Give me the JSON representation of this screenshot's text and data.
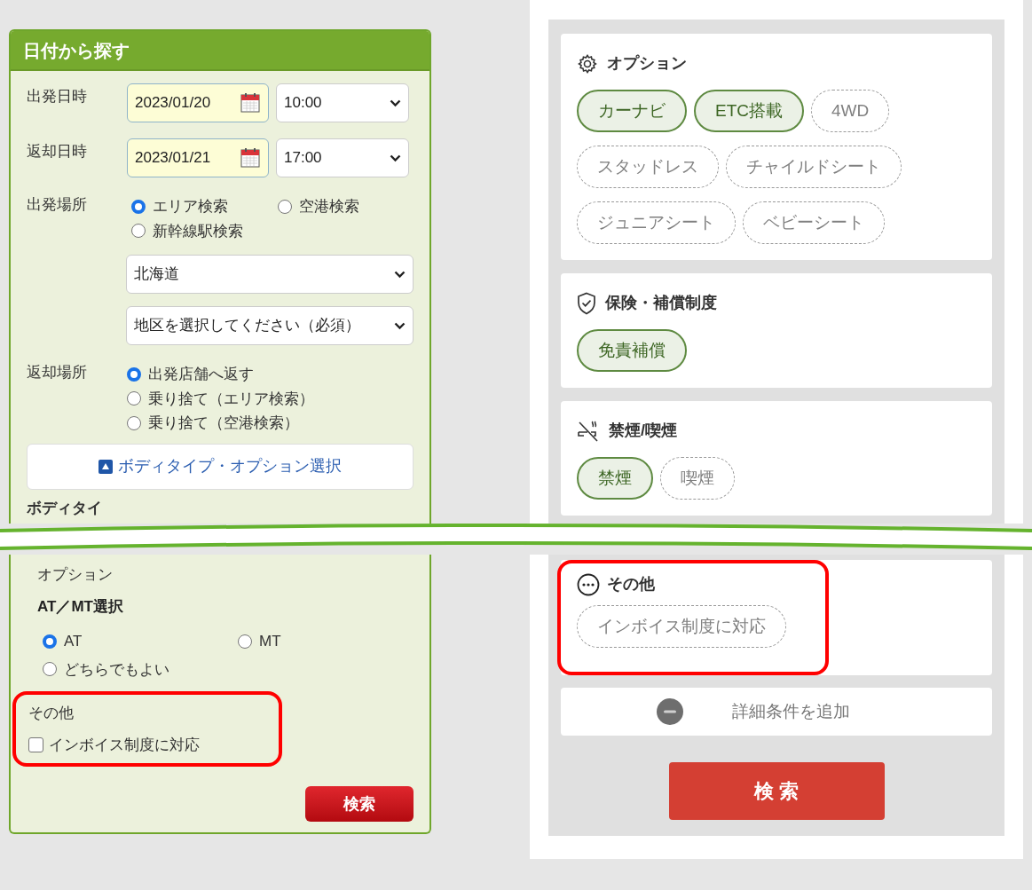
{
  "left_panel": {
    "title": "日付から探す",
    "datetime_rows": [
      {
        "label": "出発日時",
        "date": "2023/01/20",
        "time": "10:00"
      },
      {
        "label": "返却日時",
        "date": "2023/01/21",
        "time": "17:00"
      }
    ],
    "departure_place": {
      "label": "出発場所",
      "options": [
        {
          "label": "エリア検索",
          "selected": true
        },
        {
          "label": "空港検索",
          "selected": false
        },
        {
          "label": "新幹線駅検索",
          "selected": false
        }
      ],
      "selects": [
        "北海道",
        "地区を選択してください（必須）"
      ]
    },
    "return_place": {
      "label": "返却場所",
      "options": [
        {
          "label": "出発店舗へ返す",
          "selected": true
        },
        {
          "label": "乗り捨て（エリア検索）",
          "selected": false
        },
        {
          "label": "乗り捨て（空港検索）",
          "selected": false
        }
      ]
    },
    "toggle_button": "ボディタイプ・オプション選択",
    "cut_heading": "ボディタイ",
    "options_heading": "オプション",
    "transmission": {
      "label": "AT／MT選択",
      "options": [
        {
          "label": "AT",
          "selected": true
        },
        {
          "label": "MT",
          "selected": false
        },
        {
          "label": "どちらでもよい",
          "selected": false
        }
      ]
    },
    "other": {
      "label": "その他",
      "highlighted": true,
      "checkboxes": [
        {
          "label": "インボイス制度に対応",
          "checked": false
        }
      ]
    },
    "search_button": "検索"
  },
  "right_panel": {
    "sections": [
      {
        "title": "オプション",
        "chips": [
          {
            "label": "カーナビ",
            "selected": true
          },
          {
            "label": "ETC搭載",
            "selected": true
          },
          {
            "label": "4WD",
            "selected": false
          },
          {
            "label": "スタッドレス",
            "selected": false
          },
          {
            "label": "チャイルドシート",
            "selected": false
          },
          {
            "label": "ジュニアシート",
            "selected": false
          },
          {
            "label": "ベビーシート",
            "selected": false
          }
        ]
      },
      {
        "title": "保険・補償制度",
        "chips": [
          {
            "label": "免責補償",
            "selected": true
          }
        ]
      },
      {
        "title": "禁煙/喫煙",
        "chips": [
          {
            "label": "禁煙",
            "selected": true
          },
          {
            "label": "喫煙",
            "selected": false
          }
        ]
      }
    ],
    "other": {
      "title": "その他",
      "highlighted": true,
      "chips": [
        {
          "label": "インボイス制度に対応",
          "selected": false
        }
      ]
    },
    "add_conditions": "詳細条件を追加",
    "search_button": "検 索"
  }
}
